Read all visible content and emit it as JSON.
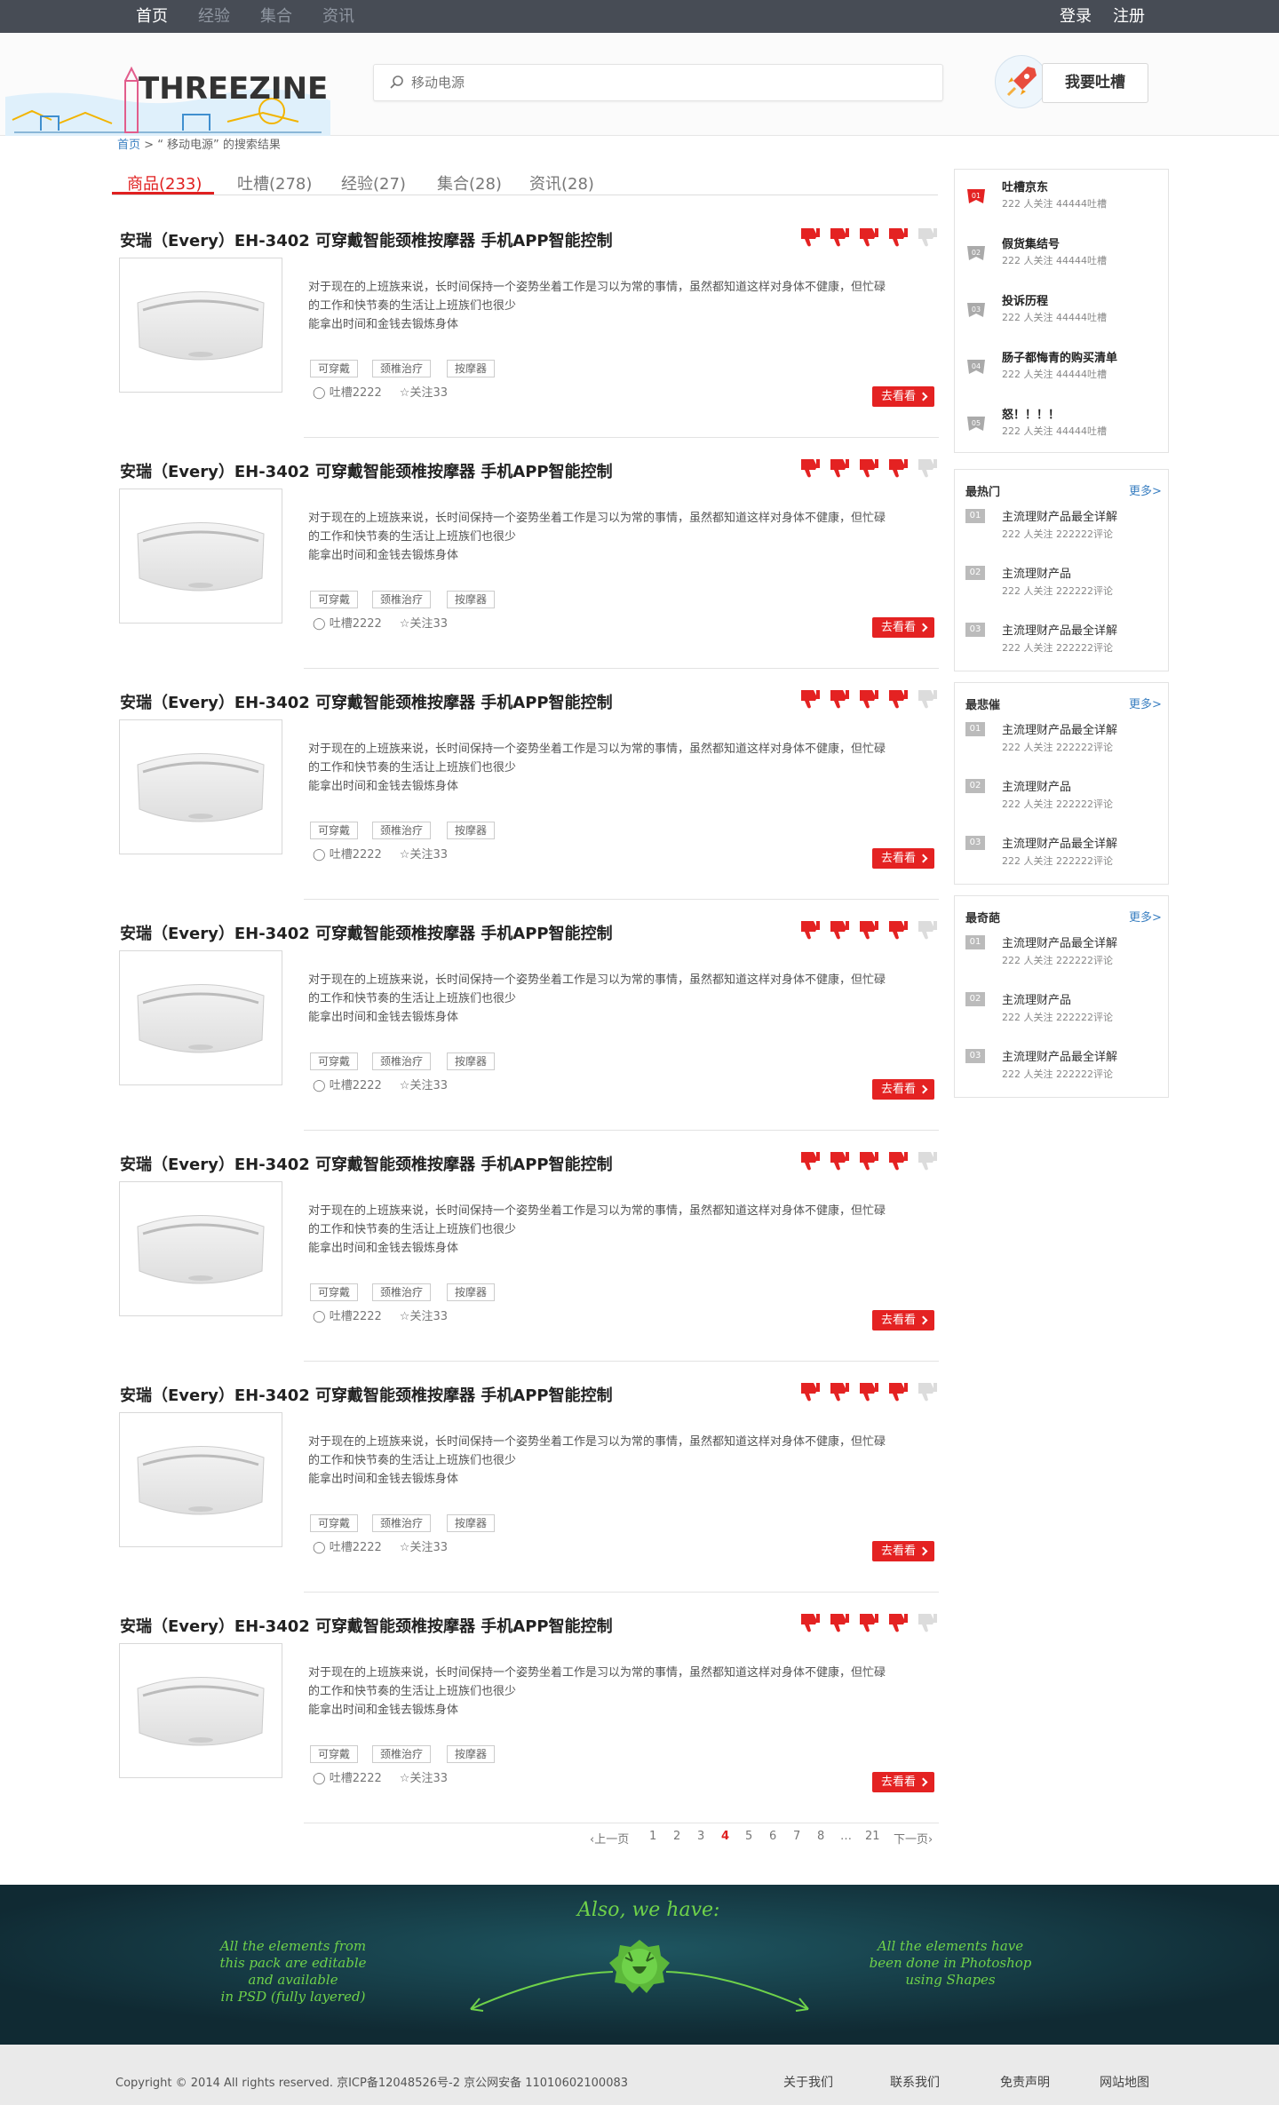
{
  "nav": {
    "links": [
      "首页",
      "经验",
      "集合",
      "资讯"
    ],
    "login": "登录",
    "register": "注册"
  },
  "header": {
    "logo_text": "THREEZINE",
    "search_placeholder": "移动电源",
    "complain_button": "我要吐槽"
  },
  "breadcrumb": {
    "home": "首页",
    "sep": " > ",
    "text": "“ 移动电源” 的搜索结果"
  },
  "tabs": [
    "商品(233)",
    "吐槽(278)",
    "经验(27)",
    "集合(28)",
    "资讯(28)"
  ],
  "item_template": {
    "title": "安瑞（Every）EH-3402 可穿戴智能颈椎按摩器 手机APP智能控制",
    "desc_line1": "对于现在的上班族来说，长时间保持一个姿势坐着工作是习以为常的事情，虽然都知道这样对身体不健康，但忙碌",
    "desc_line2": "的工作和快节奏的生活让上班族们也很少",
    "desc_line3": "能拿出时间和金钱去锻炼身体",
    "tags": [
      "可穿戴",
      "颈椎治疗",
      "按摩器"
    ],
    "comments": "吐槽2222",
    "follows": "关注33",
    "go_button": "去看看",
    "rating": 4,
    "rating_max": 5
  },
  "item_count": 7,
  "pagination": {
    "prev": "上一页",
    "pages": [
      "1",
      "2",
      "3",
      "4",
      "5",
      "6",
      "7",
      "8",
      "…",
      "21"
    ],
    "current": "4",
    "next": "下一页"
  },
  "ranking": [
    {
      "no": "01",
      "name": "吐槽京东",
      "stats": "222 人关注    44444吐槽"
    },
    {
      "no": "02",
      "name": "假货集结号",
      "stats": "222 人关注    44444吐槽"
    },
    {
      "no": "03",
      "name": "投诉历程",
      "stats": "222 人关注    44444吐槽"
    },
    {
      "no": "04",
      "name": "肠子都悔青的购买清单",
      "stats": "222 人关注    44444吐槽"
    },
    {
      "no": "05",
      "name": "怒！！！！",
      "stats": "222 人关注    44444吐槽"
    }
  ],
  "side_boxes": [
    {
      "title": "最热门",
      "more": "更多>",
      "rows": [
        {
          "no": "01",
          "title": "主流理财产品最全详解",
          "stats": "222 人关注    222222评论"
        },
        {
          "no": "02",
          "title": "主流理财产品",
          "stats": "222 人关注    222222评论"
        },
        {
          "no": "03",
          "title": "主流理财产品最全详解",
          "stats": "222 人关注    222222评论"
        }
      ]
    },
    {
      "title": "最悲催",
      "more": "更多>",
      "rows": [
        {
          "no": "01",
          "title": "主流理财产品最全详解",
          "stats": "222 人关注    222222评论"
        },
        {
          "no": "02",
          "title": "主流理财产品",
          "stats": "222 人关注    222222评论"
        },
        {
          "no": "03",
          "title": "主流理财产品最全详解",
          "stats": "222 人关注    222222评论"
        }
      ]
    },
    {
      "title": "最奇葩",
      "more": "更多>",
      "rows": [
        {
          "no": "01",
          "title": "主流理财产品最全详解",
          "stats": "222 人关注    222222评论"
        },
        {
          "no": "02",
          "title": "主流理财产品",
          "stats": "222 人关注    222222评论"
        },
        {
          "no": "03",
          "title": "主流理财产品最全详解",
          "stats": "222 人关注    222222评论"
        }
      ]
    }
  ],
  "banner": {
    "heading": "Also, we have:",
    "left_text": [
      "All the elements from",
      "this pack are editable",
      "and available",
      "in PSD (fully layered)"
    ],
    "right_text": [
      "All the elements have",
      "been done in Photoshop",
      "using Shapes"
    ]
  },
  "footer": {
    "copyright": "Copyright © 2014 All rights reserved. 京ICP备12048526号-2 京公网安备 11010602100083",
    "links": [
      "关于我们",
      "联系我们",
      "免责声明",
      "网站地图"
    ]
  },
  "colors": {
    "accent": "#e42222",
    "nav_bg": "#474c55",
    "link": "#3a7fc1",
    "banner_bg": "#143039",
    "banner_green": "#6fd24a"
  }
}
